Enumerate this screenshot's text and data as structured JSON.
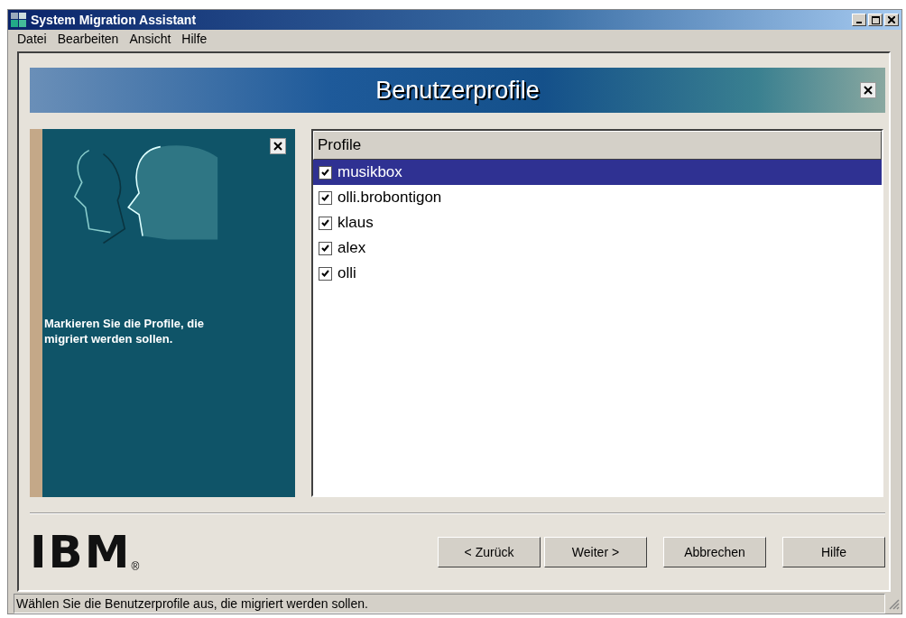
{
  "window": {
    "title": "System Migration Assistant"
  },
  "menu": [
    {
      "label": "Datei"
    },
    {
      "label": "Bearbeiten"
    },
    {
      "label": "Ansicht"
    },
    {
      "label": "Hilfe"
    }
  ],
  "banner": {
    "title": "Benutzerprofile"
  },
  "side_panel": {
    "text": "Markieren Sie die Profile, die migriert werden sollen."
  },
  "profiles": {
    "column": "Profile",
    "rows": [
      {
        "name": "musikbox",
        "checked": true,
        "selected": true
      },
      {
        "name": "olli.brobontigon",
        "checked": true,
        "selected": false
      },
      {
        "name": "klaus",
        "checked": true,
        "selected": false
      },
      {
        "name": "alex",
        "checked": true,
        "selected": false
      },
      {
        "name": "olli",
        "checked": true,
        "selected": false
      }
    ]
  },
  "logo": {
    "text": "IBM",
    "mark": "®"
  },
  "buttons": [
    {
      "label": "< Zurück"
    },
    {
      "label": "Weiter >"
    },
    {
      "label": "Abbrechen"
    },
    {
      "label": "Hilfe"
    }
  ],
  "status_bar": "Wählen Sie die Benutzerprofile aus, die migriert werden sollen."
}
